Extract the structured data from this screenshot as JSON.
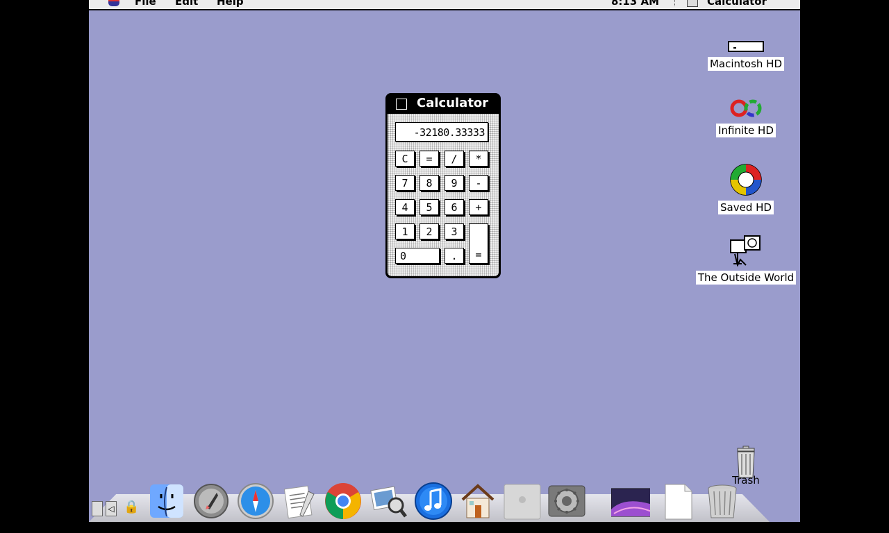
{
  "menubar": {
    "items": [
      "File",
      "Edit",
      "Help"
    ],
    "clock": "8:13 AM",
    "app_name": "Calculator"
  },
  "calculator": {
    "title": "Calculator",
    "display": "-32180.33333",
    "keys": {
      "clear": "C",
      "equals_top": "=",
      "divide": "/",
      "multiply": "*",
      "seven": "7",
      "eight": "8",
      "nine": "9",
      "minus": "-",
      "four": "4",
      "five": "5",
      "six": "6",
      "plus": "+",
      "one": "1",
      "two": "2",
      "three": "3",
      "zero": "0",
      "decimal": ".",
      "equals": "="
    }
  },
  "desktop_icons": [
    {
      "label": "Macintosh HD",
      "icon": "hard-drive-icon"
    },
    {
      "label": "Infinite HD",
      "icon": "infinite-hd-icon"
    },
    {
      "label": "Saved HD",
      "icon": "lifebuoy-icon"
    },
    {
      "label": "The Outside World",
      "icon": "network-icon"
    },
    {
      "label": "Trash",
      "icon": "trash-icon"
    }
  ],
  "dock": [
    {
      "icon": "finder-icon"
    },
    {
      "icon": "launchpad-icon"
    },
    {
      "icon": "safari-icon"
    },
    {
      "icon": "textedit-icon"
    },
    {
      "icon": "chrome-icon"
    },
    {
      "icon": "preview-icon"
    },
    {
      "icon": "itunes-icon"
    },
    {
      "icon": "home-icon"
    },
    {
      "icon": "mac-pro-icon"
    },
    {
      "icon": "system-preferences-icon"
    },
    {
      "icon": "desktop-picture-icon"
    },
    {
      "icon": "document-icon"
    },
    {
      "icon": "trash-icon"
    }
  ],
  "colors": {
    "desktop": "#9a9ccc",
    "menubar": "#ececec",
    "window_frame": "#000000"
  }
}
